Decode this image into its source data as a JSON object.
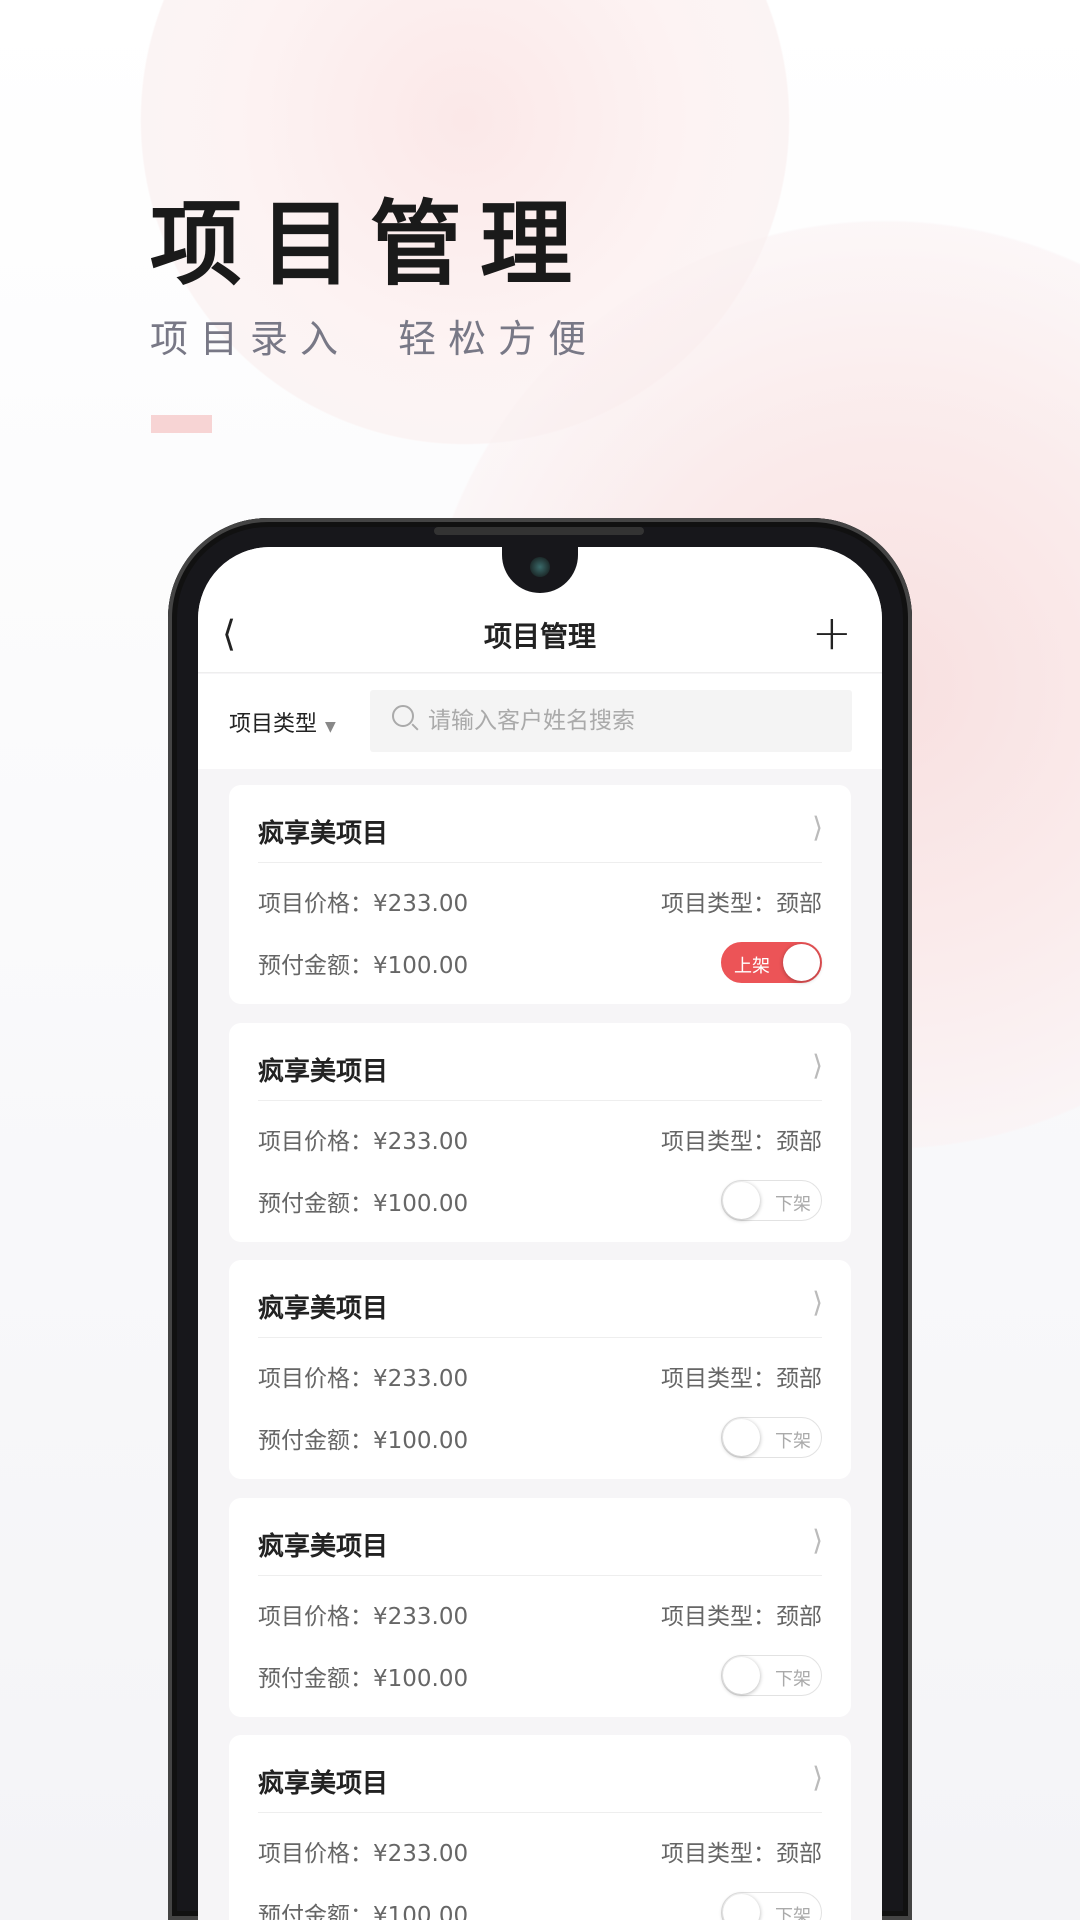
{
  "hero": {
    "title": "项目管理",
    "subtitle": "项目录入  轻松方便"
  },
  "colors": {
    "accent": "#ec5457",
    "pink_bar": "#f7d4d4"
  },
  "nav": {
    "back_icon": "chevron-left-icon",
    "title": "项目管理",
    "add_icon": "plus-icon"
  },
  "filter": {
    "type_label": "项目类型",
    "search_placeholder": "请输入客户姓名搜索",
    "search_value": ""
  },
  "items": [
    {
      "name": "疯享美项目",
      "price": "项目价格：¥233.00",
      "type": "项目类型：颈部",
      "prepay": "预付金额：¥100.00",
      "status": "上架",
      "on": true
    },
    {
      "name": "疯享美项目",
      "price": "项目价格：¥233.00",
      "type": "项目类型：颈部",
      "prepay": "预付金额：¥100.00",
      "status": "下架",
      "on": false
    },
    {
      "name": "疯享美项目",
      "price": "项目价格：¥233.00",
      "type": "项目类型：颈部",
      "prepay": "预付金额：¥100.00",
      "status": "下架",
      "on": false
    },
    {
      "name": "疯享美项目",
      "price": "项目价格：¥233.00",
      "type": "项目类型：颈部",
      "prepay": "预付金额：¥100.00",
      "status": "下架",
      "on": false
    },
    {
      "name": "疯享美项目",
      "price": "项目价格：¥233.00",
      "type": "项目类型：颈部",
      "prepay": "预付金额：¥100.00",
      "status": "下架",
      "on": false
    }
  ]
}
